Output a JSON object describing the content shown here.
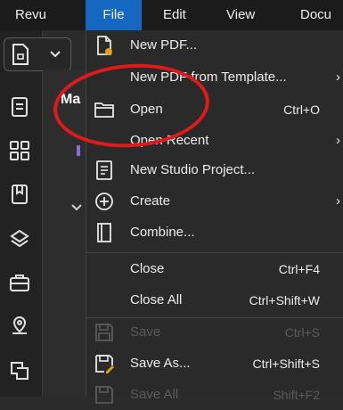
{
  "menubar": {
    "items": [
      {
        "label": "Revu"
      },
      {
        "label": "File",
        "active": true
      },
      {
        "label": "Edit"
      },
      {
        "label": "View"
      },
      {
        "label": "Docu"
      }
    ]
  },
  "left_toolbar": {
    "icons": [
      "document-icon",
      "properties-icon",
      "thumbnails-icon",
      "bookmarks-icon",
      "layers-icon",
      "toolchest-icon",
      "location-icon",
      "measurements-icon"
    ]
  },
  "panel": {
    "title": "Ma"
  },
  "file_menu": {
    "items": [
      {
        "label": "New PDF...",
        "shortcut": "",
        "submenu": false,
        "disabled": false,
        "icon": "new-pdf-icon"
      },
      {
        "label": "New PDF from Template...",
        "shortcut": "",
        "submenu": true,
        "disabled": false,
        "icon": ""
      },
      {
        "label": "Open",
        "shortcut": "Ctrl+O",
        "submenu": false,
        "disabled": false,
        "icon": "folder-icon"
      },
      {
        "label": "Open Recent",
        "shortcut": "",
        "submenu": true,
        "disabled": false,
        "icon": ""
      },
      {
        "label": "New Studio Project...",
        "shortcut": "",
        "submenu": false,
        "disabled": false,
        "icon": "studio-project-icon"
      },
      {
        "label": "Create",
        "shortcut": "",
        "submenu": true,
        "disabled": false,
        "icon": "plus-circle-icon"
      },
      {
        "label": "Combine...",
        "shortcut": "",
        "submenu": false,
        "disabled": false,
        "icon": "combine-icon"
      },
      {
        "label": "Close",
        "shortcut": "Ctrl+F4",
        "submenu": false,
        "disabled": false,
        "icon": ""
      },
      {
        "label": "Close All",
        "shortcut": "Ctrl+Shift+W",
        "submenu": false,
        "disabled": false,
        "icon": ""
      },
      {
        "label": "Save",
        "shortcut": "Ctrl+S",
        "submenu": false,
        "disabled": true,
        "icon": "save-icon"
      },
      {
        "label": "Save As...",
        "shortcut": "Ctrl+Shift+S",
        "submenu": false,
        "disabled": false,
        "icon": "save-as-icon"
      },
      {
        "label": "Save All",
        "shortcut": "Shift+F2",
        "submenu": false,
        "disabled": true,
        "icon": "save-all-icon"
      }
    ],
    "submenu_arrow": "›"
  },
  "colors": {
    "active_menu": "#1667c2",
    "highlight_ring": "#e01919",
    "accent_icon": "#e3a31b",
    "disabled_text": "#5b5b5b"
  }
}
